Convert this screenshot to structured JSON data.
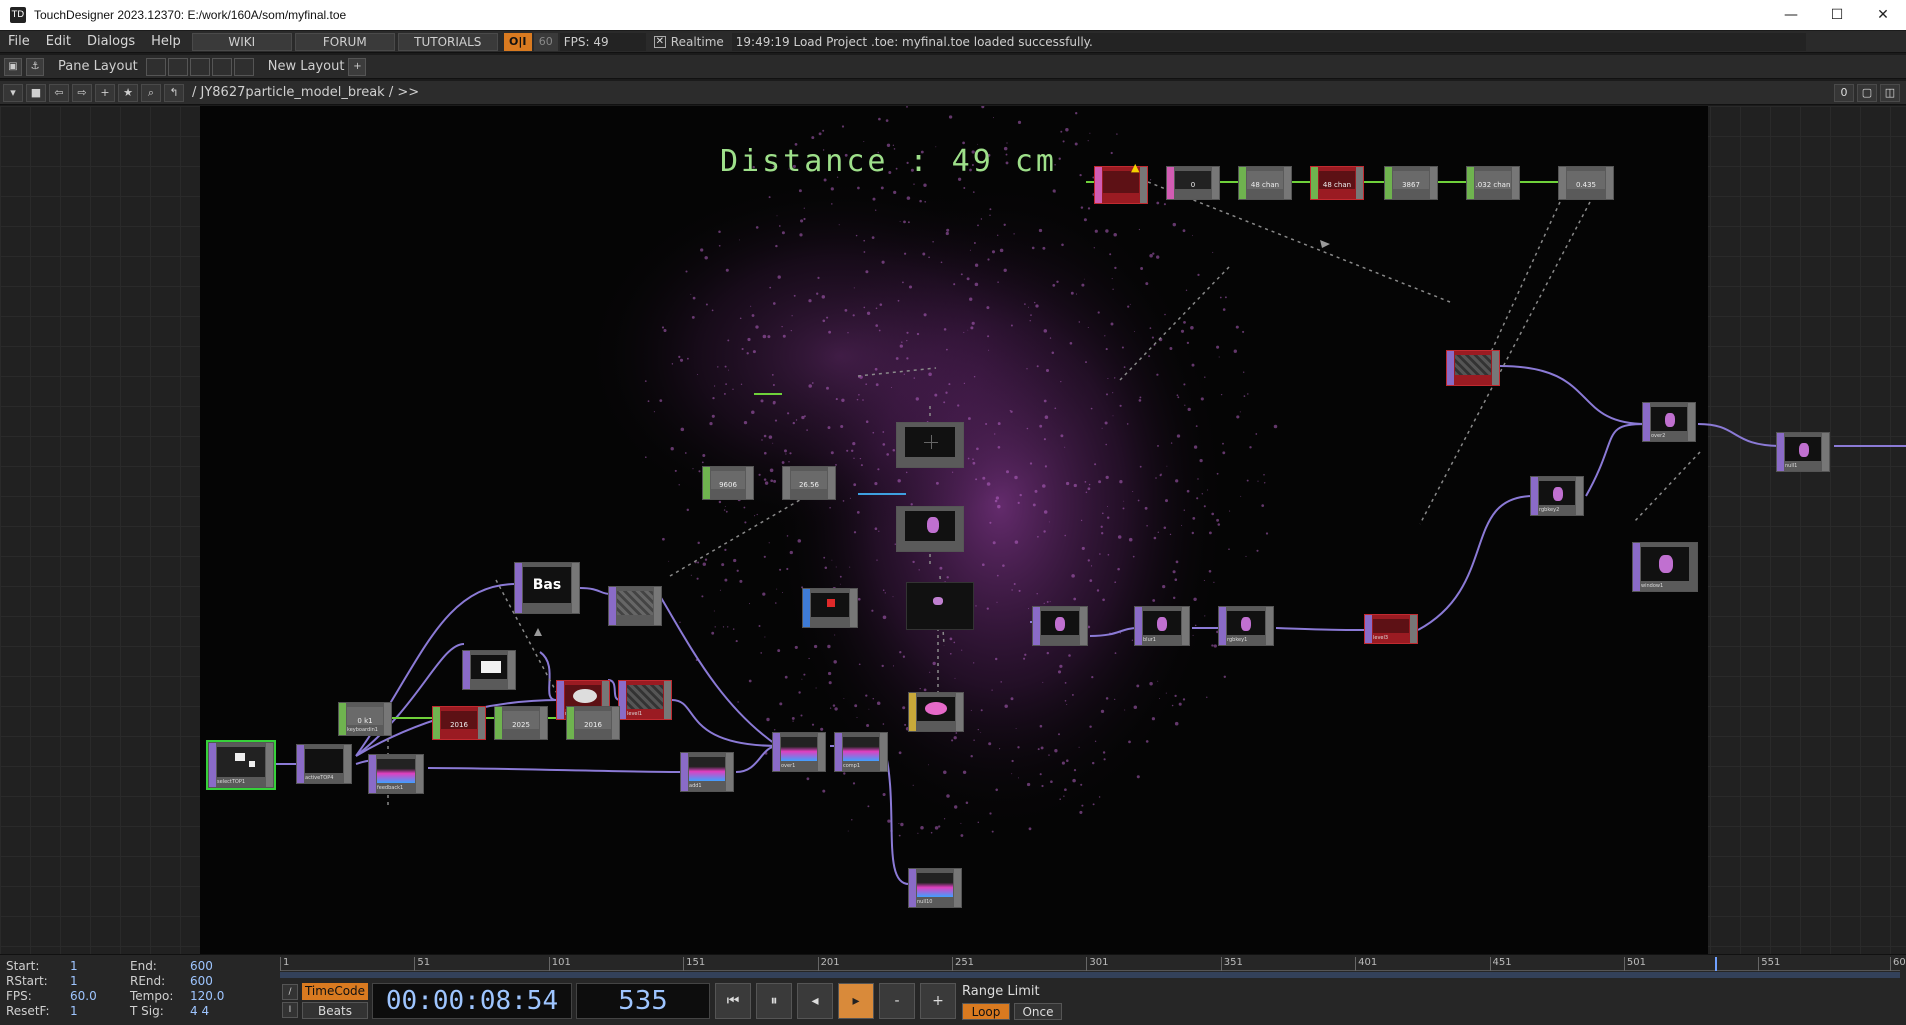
{
  "window": {
    "title": "TouchDesigner 2023.12370: E:/work/160A/som/myfinal.toe",
    "app_icon": "TD",
    "controls": [
      "—",
      "☐",
      "✕"
    ]
  },
  "menubar": {
    "menus": [
      "File",
      "Edit",
      "Dialogs",
      "Help"
    ],
    "buttons": [
      "WIKI",
      "FORUM",
      "TUTORIALS"
    ],
    "oi": "O|I",
    "fps_value": "60",
    "fps_label": "FPS:  49",
    "realtime_check": "✕",
    "realtime": "Realtime",
    "status": "19:49:19 Load Project .toe: myfinal.toe loaded successfully."
  },
  "panebar": {
    "pane_layout": "Pane Layout",
    "new_layout": "New Layout",
    "add": "+"
  },
  "pathbar": {
    "path": "/ JY8627particle_model_break / >>",
    "right_count": "0"
  },
  "network": {
    "distance_text": "Distance :  49 cm",
    "nodes": {
      "bas": "Bas",
      "chop_count1": "9606 chan",
      "chop_count2": "26.56 chan1",
      "chop_top1": "0",
      "chop_top2": "48 chan",
      "chop_top3": "48 chan",
      "chop_top4": "3867 chan",
      "chop_top5": ".032 chan",
      "chop_top6": "0.435 chan1",
      "chop_kb1": "0 k1",
      "chop_kb2": "2016 chan",
      "chop_kb3": "2025 chan",
      "chop_kb4": "2016 chan",
      "lbl_select": "selectTOP1",
      "lbl_analyze": "activeTOP4",
      "lbl_feedback": "feedback1",
      "lbl_keyboard": "keyboardin1",
      "lbl_noise": "noise1",
      "lbl_level": "level1",
      "lbl_add": "add1",
      "lbl_over": "over1",
      "lbl_comp": "comp1",
      "lbl_null": "null10",
      "lbl_blur": "blur1",
      "lbl_rgbkey": "rgbkey1",
      "lbl_level3": "level3",
      "lbl_rgbkey2": "rgbkey2",
      "lbl_over2": "over2",
      "lbl_null1": "null1",
      "lbl_window": "window1"
    }
  },
  "timeline": {
    "stats": [
      {
        "k": "Start:",
        "v": "1",
        "k2": "End:",
        "v2": "600"
      },
      {
        "k": "RStart:",
        "v": "1",
        "k2": "REnd:",
        "v2": "600"
      },
      {
        "k": "FPS:",
        "v": "60.0",
        "k2": "Tempo:",
        "v2": "120.0"
      },
      {
        "k": "ResetF:",
        "v": "1",
        "k2": "T Sig:",
        "v2": "4     4"
      }
    ],
    "ticks": [
      "1",
      "51",
      "101",
      "151",
      "201",
      "251",
      "301",
      "351",
      "401",
      "451",
      "501",
      "551",
      "600"
    ],
    "playhead_frame": 535,
    "timecode_label": "TimeCode",
    "beats_label": "Beats",
    "timecode": "00:00:08:54",
    "frame": "535",
    "buttons": [
      "⏮",
      "⏸",
      "◂",
      "▸",
      "-",
      "+"
    ],
    "range_limit": "Range Limit",
    "loop": "Loop",
    "once": "Once"
  }
}
